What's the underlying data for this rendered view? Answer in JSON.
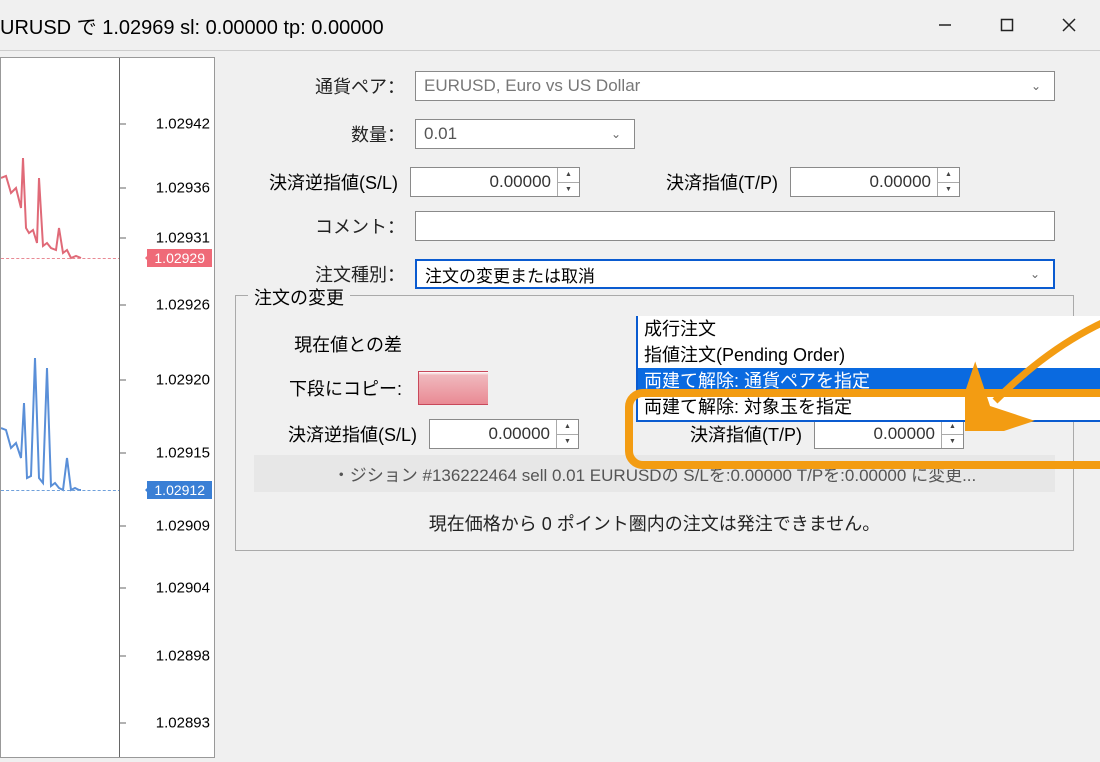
{
  "window": {
    "title": "URUSD で 1.02969 sl: 0.00000 tp: 0.00000"
  },
  "priceAxis": {
    "ticks": [
      "1.02942",
      "1.02936",
      "1.02931",
      "1.02926",
      "1.02920",
      "1.02915",
      "1.02909",
      "1.02904",
      "1.02898",
      "1.02893"
    ],
    "ask": "1.02929",
    "bid": "1.02912"
  },
  "form": {
    "pairLabel": "通貨ペア：",
    "pairValue": "EURUSD, Euro vs US Dollar",
    "qtyLabel": "数量：",
    "qtyValue": "0.01",
    "slLabel": "決済逆指値(S/L)",
    "slValue": "0.00000",
    "tpLabel": "決済指値(T/P)",
    "tpValue": "0.00000",
    "commentLabel": "コメント：",
    "orderTypeLabel": "注文種別：",
    "orderTypeValue": "注文の変更または取消",
    "orderTypeOptions": [
      "成行注文",
      "指値注文(Pending Order)",
      "注文の変更または取消",
      "両建て解除: 通貨ペアを指定",
      "両建て解除: 対象玉を指定"
    ],
    "orderTypeSelectedIndex": 3
  },
  "groupbox": {
    "title": "注文の変更",
    "diffLabel": "現在値との差",
    "copyLabel": "下段にコピー:",
    "slLabel": "決済逆指値(S/L)",
    "slValue": "0.00000",
    "tpLabel": "決済指値(T/P)",
    "tpValue": "0.00000",
    "statusBar": "・ジション #136222464 sell 0.01 EURUSDの S/Lを:0.00000 T/Pを:0.00000 に変更...",
    "footnote": "現在価格から 0 ポイント圏内の注文は発注できません。"
  }
}
